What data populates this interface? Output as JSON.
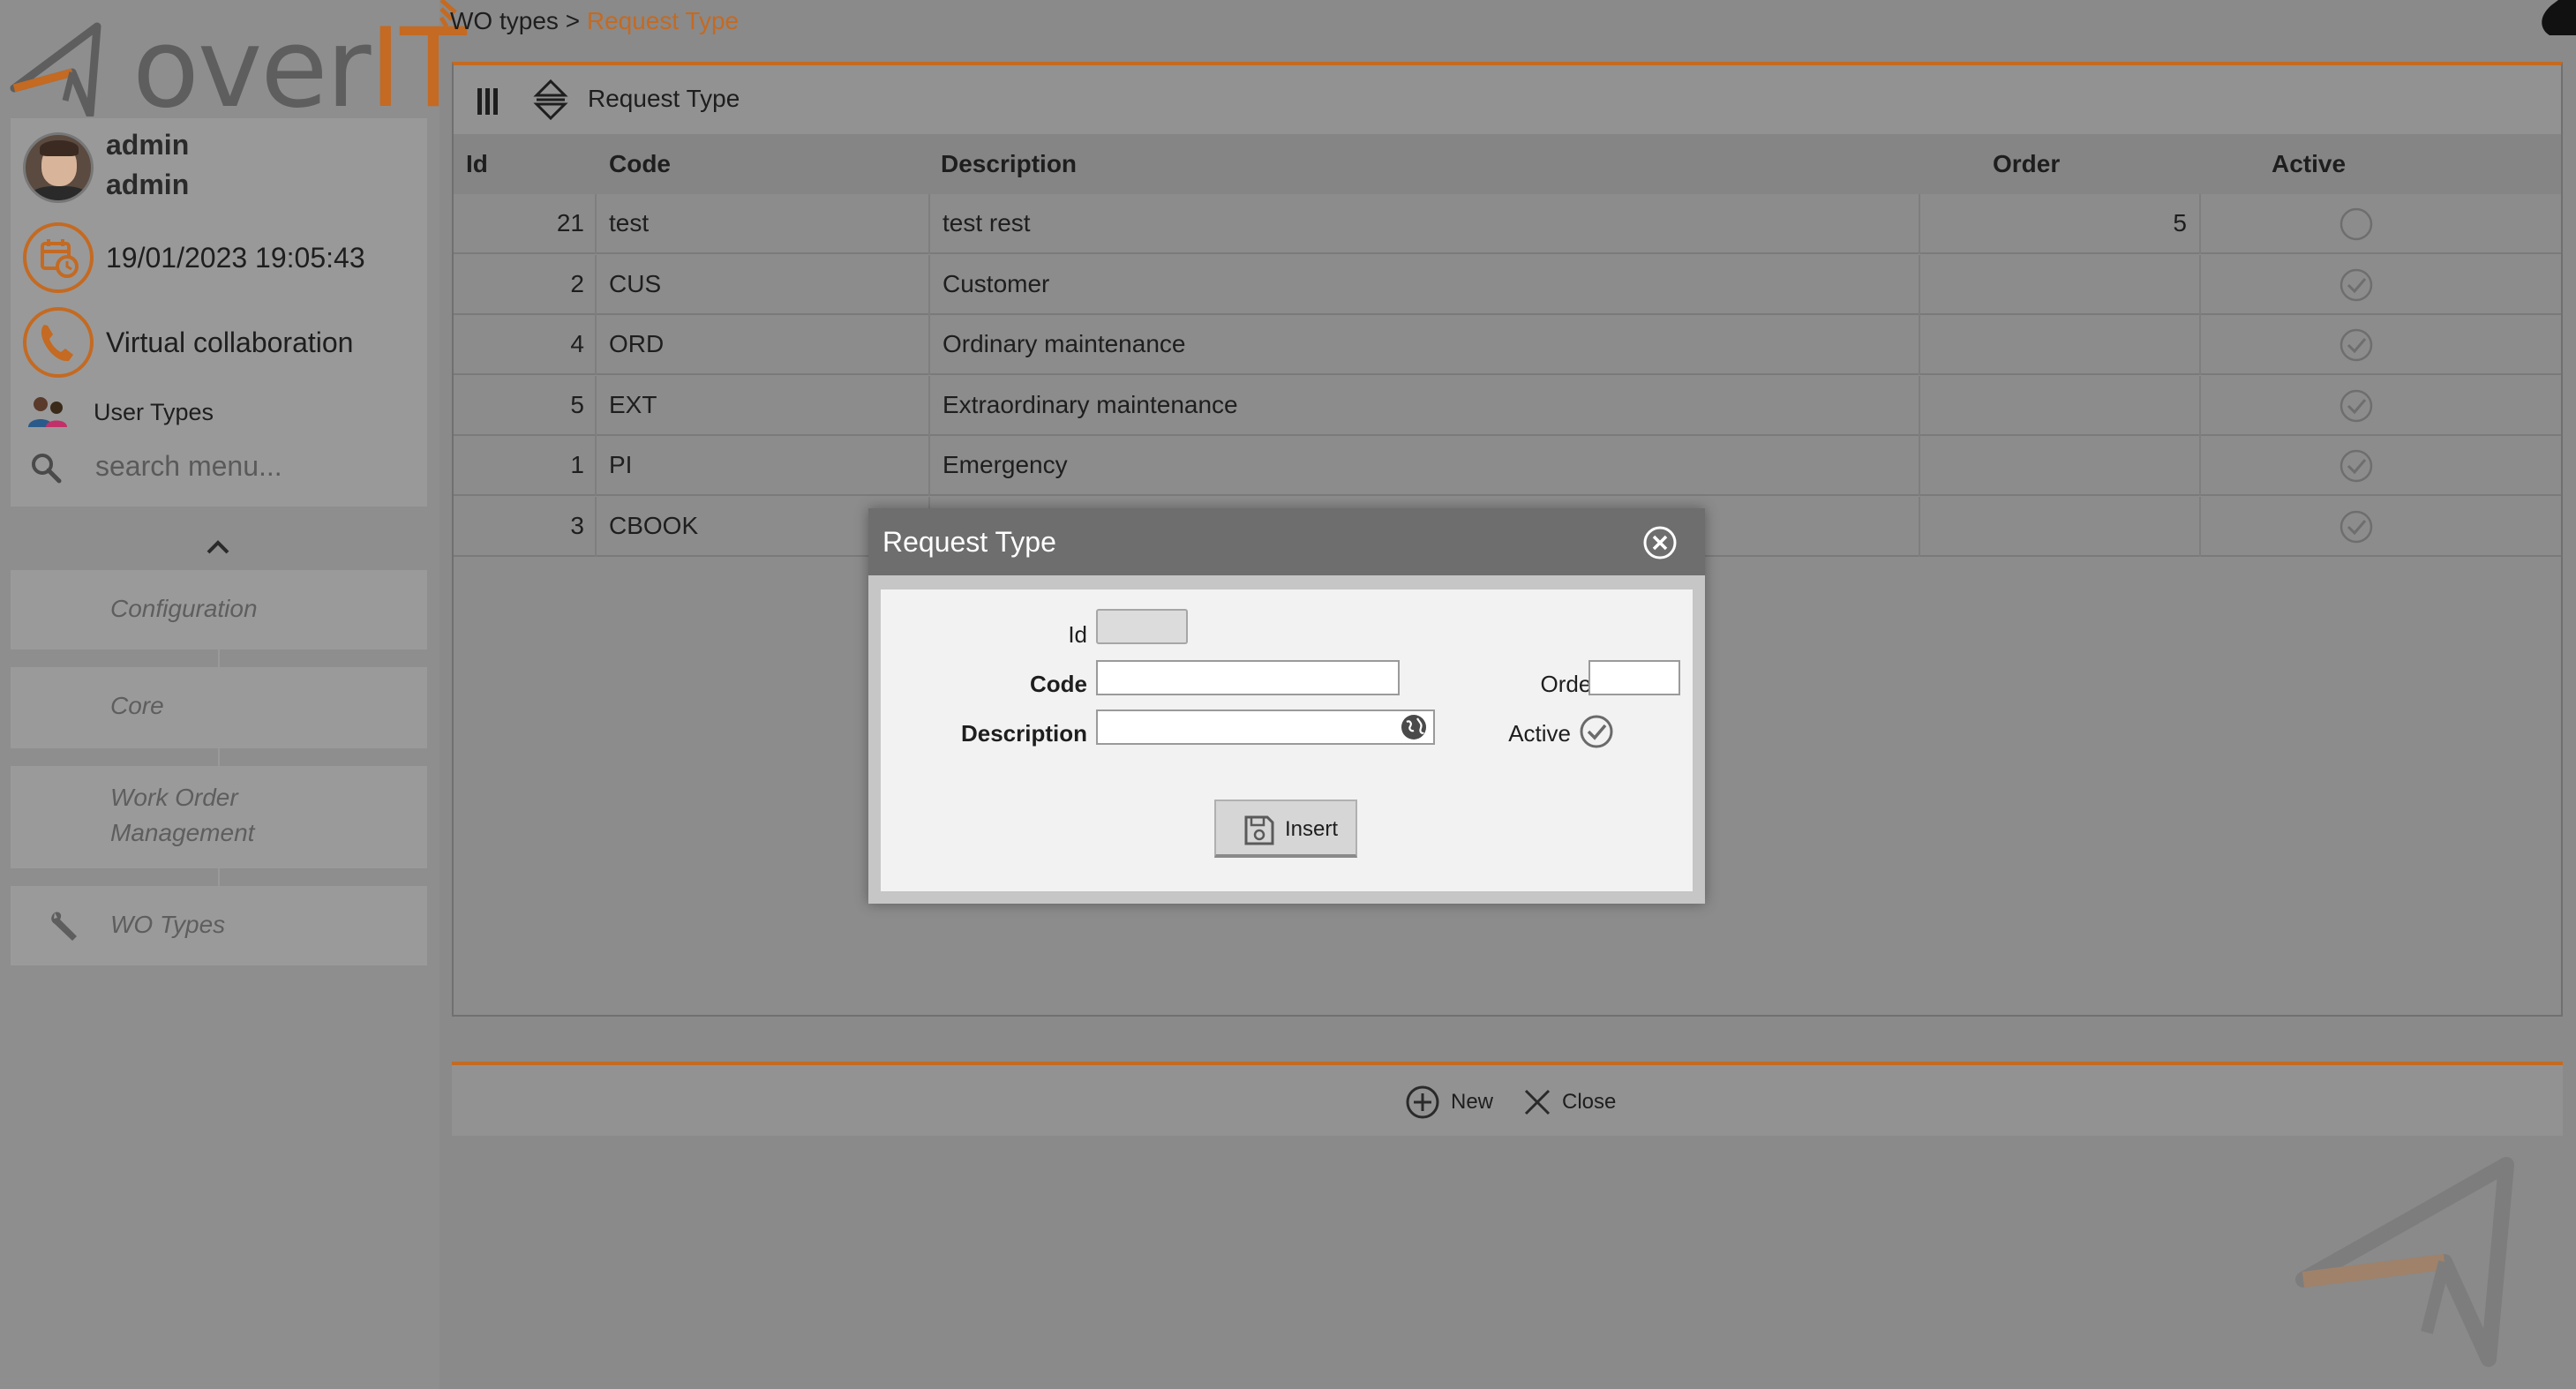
{
  "app": {
    "logo_over": "over",
    "logo_it": "IT"
  },
  "colors": {
    "accent": "#c46a22",
    "modal_header": "#6e6e6e"
  },
  "user": {
    "first_name": "admin",
    "last_name": "admin"
  },
  "datetime": "19/01/2023 19:05:43",
  "sidebar": {
    "virtual_collaboration": "Virtual collaboration",
    "user_types": "User Types",
    "search_placeholder": "search menu...",
    "menu": [
      {
        "label": "Configuration"
      },
      {
        "label": "Core"
      },
      {
        "label": "Work Order Management"
      },
      {
        "label": "WO Types",
        "icon": "wrench-icon"
      }
    ]
  },
  "breadcrumb": {
    "parent": "WO types",
    "separator": ">",
    "current": "Request Type"
  },
  "grid": {
    "title": "Request Type",
    "columns": [
      "Id",
      "Code",
      "Description",
      "Order",
      "Active"
    ],
    "rows": [
      {
        "id": "21",
        "code": "test",
        "description": "test rest",
        "order": "5",
        "active": false
      },
      {
        "id": "2",
        "code": "CUS",
        "description": "Customer",
        "order": "",
        "active": true
      },
      {
        "id": "4",
        "code": "ORD",
        "description": "Ordinary maintenance",
        "order": "",
        "active": true
      },
      {
        "id": "5",
        "code": "EXT",
        "description": "Extraordinary maintenance",
        "order": "",
        "active": true
      },
      {
        "id": "1",
        "code": "PI",
        "description": "Emergency",
        "order": "",
        "active": true
      },
      {
        "id": "3",
        "code": "CBOOK",
        "description": "",
        "order": "",
        "active": true
      }
    ]
  },
  "actions": {
    "new_label": "New",
    "close_label": "Close"
  },
  "modal": {
    "title": "Request Type",
    "labels": {
      "id": "Id",
      "code": "Code",
      "description": "Description",
      "order": "Order",
      "active": "Active"
    },
    "values": {
      "id": "",
      "code": "",
      "description": "",
      "order": ""
    },
    "active_checked": true,
    "insert_label": "Insert"
  }
}
